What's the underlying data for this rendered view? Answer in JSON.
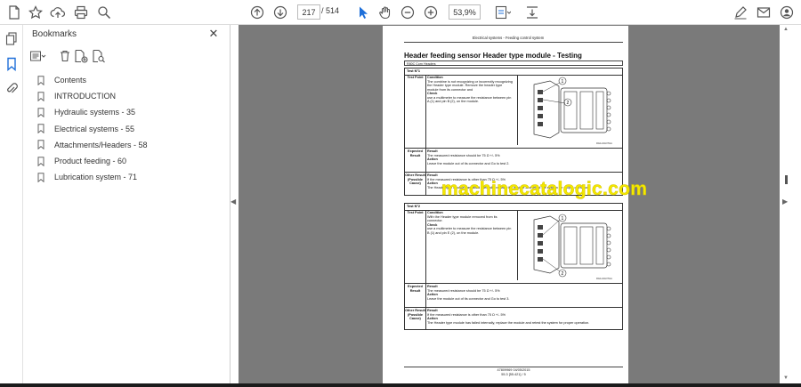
{
  "toolbar": {
    "current_page": "217",
    "page_separator": "/",
    "total_pages": "514",
    "zoom": "53,9%"
  },
  "bookmarks": {
    "title": "Bookmarks",
    "items": [
      {
        "label": "Contents"
      },
      {
        "label": "INTRODUCTION"
      },
      {
        "label": "Hydraulic systems - 35"
      },
      {
        "label": "Electrical systems - 55"
      },
      {
        "label": "Attachments/Headers - 58"
      },
      {
        "label": "Product feeding - 60"
      },
      {
        "label": "Lubrication system - 71"
      }
    ]
  },
  "document": {
    "running_header": "Electrical systems - Feeding control system",
    "title": "Header feeding sensor Header type module - Testing",
    "model": "R80C Corn Headers",
    "test1": {
      "label": "Test N°1",
      "test_point": "Test Point",
      "condition_head": "Condition",
      "condition_text": "The combine is not recognizing or incorrectly recognizing the Header type module. Remove the header type module from its connector and",
      "check_head": "Check",
      "check_text": "use a multimeter to measure the resistance between pin A (1) and pin B (2), on the module.",
      "figure_id": "RAIL14GOTHA",
      "expected": "Expected Result",
      "result_head": "Result",
      "result_text": "The measured resistance should be 75 Ω +/- 5%",
      "action_head": "Action",
      "action_text": "Leave the module out of its connector and Go to test 2.",
      "other": "Other Result (Possible Cause)",
      "other_text": "If the measured resistance is other than 75 Ω +/- 5%",
      "other_action_text": "The Header type module has failed internally, replace the module and retest the system for proper operation."
    },
    "test2": {
      "label": "Test N°2",
      "test_point": "Test Point",
      "condition_head": "Condition",
      "condition_text": "With the Header type module removed from its connector.",
      "check_head": "Check",
      "check_text": "use a multimeter to measure the resistance between pin B (1) and pin E (2), on the module.",
      "figure_id": "RAIL14GOTHA",
      "expected": "Expected Result",
      "result_head": "Result",
      "result_text": "The measured resistance should be 75 Ω +/- 5%",
      "action_head": "Action",
      "action_text": "Leave the module out of its connector and Go to test 3.",
      "other": "Other Result (Possible Cause)",
      "other_text": "If the measured resistance is other than 75 Ω +/- 5%",
      "action2_head": "Action",
      "other_action_text": "The Header type module has failed internally, replace the module and retest the system for proper operation."
    },
    "footer_code": "47809969 04/05/2015",
    "footer_page": "55.3 [55.421] / 5",
    "watermark": "machinecatalogic.com"
  },
  "colors": {
    "viewer_bg": "#7a7a7a",
    "watermark": "#f4e800",
    "accent": "#1e6fd9"
  }
}
